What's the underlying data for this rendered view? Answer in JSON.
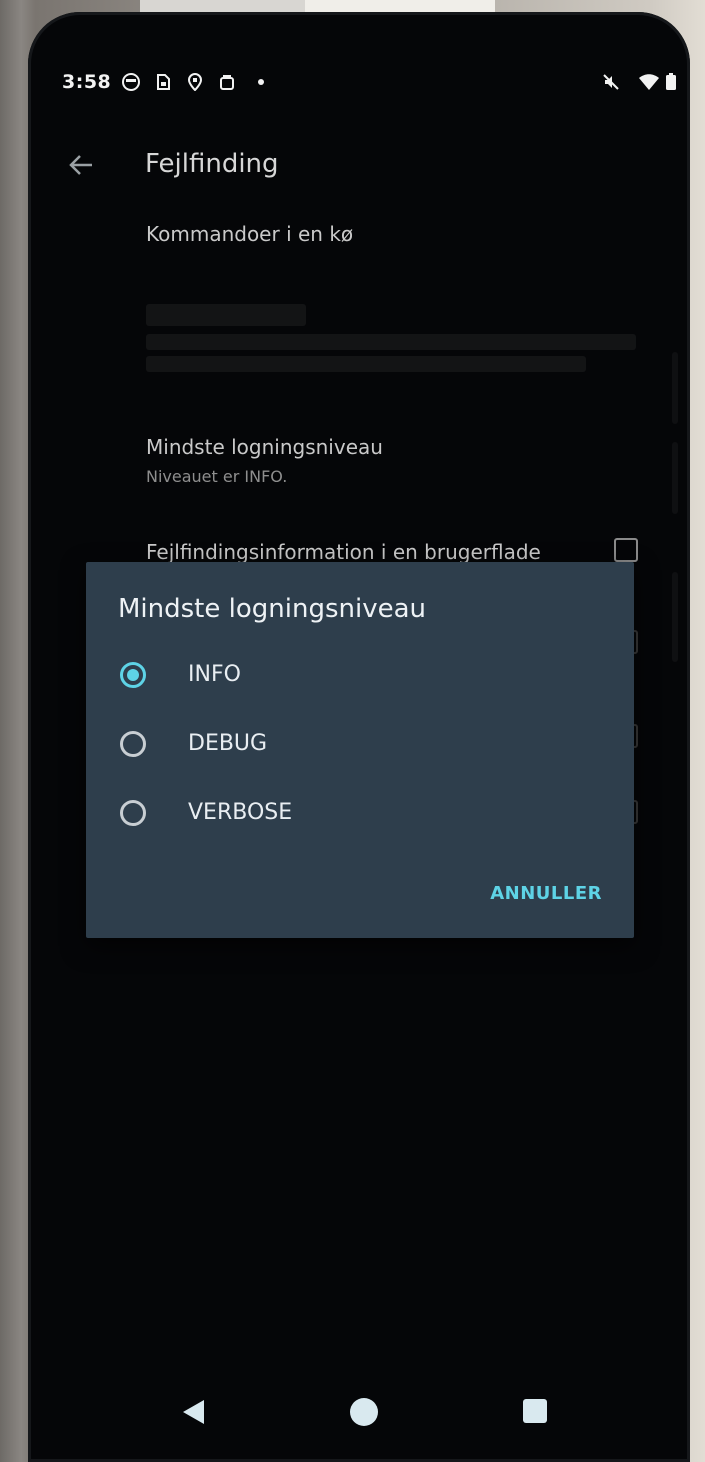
{
  "status_bar": {
    "time": "3:58",
    "icons": [
      "face-icon",
      "sim-icon",
      "location-icon",
      "bag-icon",
      "dot-icon"
    ],
    "right_icons": [
      "mute-icon",
      "wifi-icon",
      "battery-icon"
    ]
  },
  "app_bar": {
    "title": "Fejlfinding",
    "back_icon": "back-arrow-icon"
  },
  "preferences": [
    {
      "title": "Kommandoer i en kø"
    },
    {
      "title": "Mindste logningsniveau",
      "subtitle": "Niveauet er INFO."
    },
    {
      "title": "Fejlfindingsinformation i en brugerflade"
    }
  ],
  "dialog": {
    "title": "Mindste logningsniveau",
    "options": [
      {
        "label": "INFO",
        "selected": true
      },
      {
        "label": "DEBUG",
        "selected": false
      },
      {
        "label": "VERBOSE",
        "selected": false
      }
    ],
    "cancel_label": "ANNULLER",
    "accent_color": "#5ED3E6",
    "background_color": "#2E3E4C"
  },
  "nav_bar": {
    "icons": [
      "nav-back-icon",
      "nav-home-icon",
      "nav-recents-icon"
    ]
  }
}
